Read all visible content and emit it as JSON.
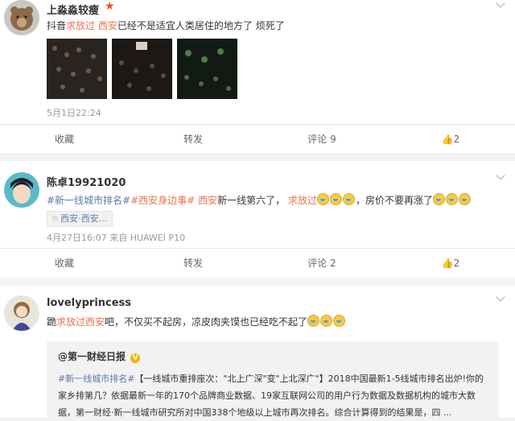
{
  "post1": {
    "user": "上淼淼较瘦",
    "text_pre": "抖音",
    "text_hl1": "求放过",
    "text_hl2": "西安",
    "text_post": "已经不是适宜人类居住的地方了 烦死了",
    "time": "5月1日22:24",
    "actions": [
      "收藏",
      "转发",
      "评论 9",
      "2"
    ]
  },
  "post2": {
    "user": "陈卓19921020",
    "tag1": "#新一线城市排名#",
    "tag2": "#西安身边事#",
    "hl_city": "西安",
    "text_mid": "新一线第六了，",
    "hl_plea": "求放过",
    "text_end": "，房价不要再涨了",
    "location": "西安·西安...",
    "meta": "4月27日16:07 来自 HUAWEI P10",
    "actions": [
      "收藏",
      "转发",
      "评论 2",
      "2"
    ]
  },
  "post3": {
    "user": "lovelyprincess",
    "text_pre": "跪",
    "hl_plea": "求放过",
    "hl_city": "西安",
    "text_post": "吧，不仅买不起房，凉皮肉夹馍也已经吃不起了",
    "quote": {
      "source": "@第一财经日报",
      "tag": "#新一线城市排名#",
      "line1": "【一线城市重排座次：\"北上广深\"变\"上北深广\"】2018中国最新1-5线城市排名出炉!你的",
      "line2": "家乡排第几？依据最新一年的170个品牌商业数据、19家互联网公司的用户行为数据及数据机构的城市大数",
      "line3": "据，第一财经·新一线城市研究所对中国338个地级以上城市再次排名。综合计算得到的结果是，四 ..."
    }
  },
  "colors": {
    "highlight": "#eb7350",
    "link": "#5b7ba6"
  }
}
